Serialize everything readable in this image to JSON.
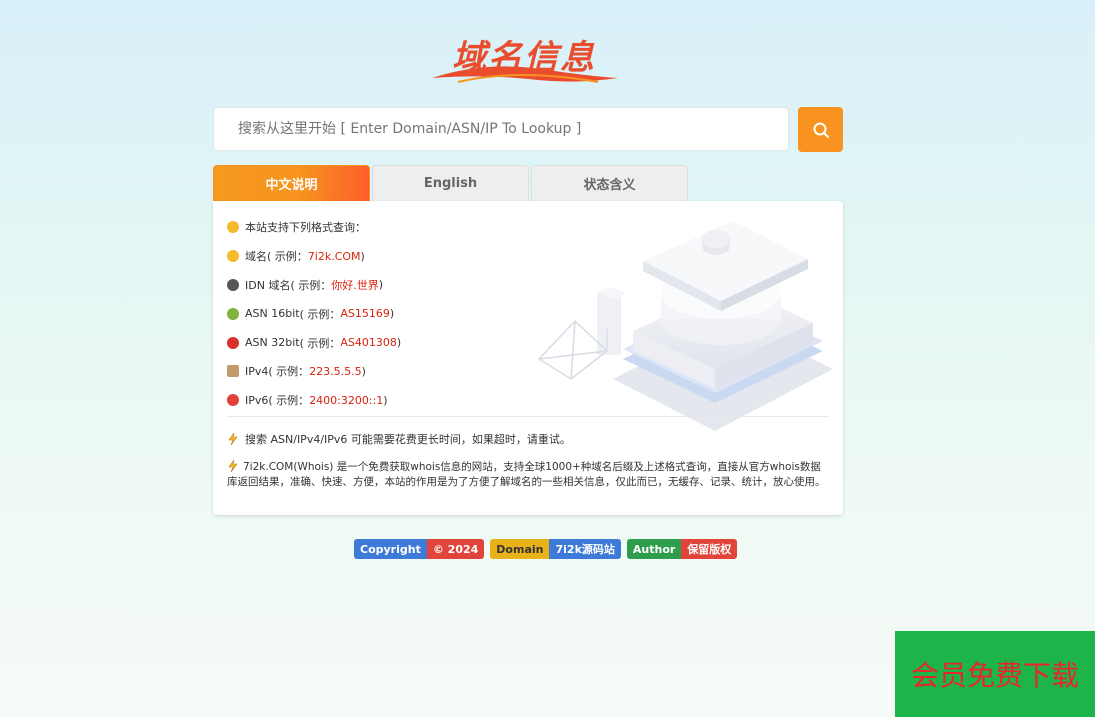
{
  "logo": {
    "text": "域名信息"
  },
  "search": {
    "placeholder": "搜索从这里开始 [ Enter Domain/ASN/IP To Lookup ]",
    "value": ""
  },
  "tabs": [
    {
      "label": "中文说明",
      "active": true
    },
    {
      "label": "English",
      "active": false
    },
    {
      "label": "状态含义",
      "active": false
    }
  ],
  "panel": {
    "intro": "本站支持下列格式查询：",
    "formats": [
      {
        "icon": "emoji-cool-icon",
        "label": "域名",
        "prefix": " ( 示例：",
        "example": "7i2k.COM",
        "suffix": " )"
      },
      {
        "icon": "emoji-eyes-icon",
        "label": "IDN 域名",
        "prefix": " ( 示例：",
        "example": "你好.世界",
        "suffix": " )"
      },
      {
        "icon": "emoji-sprout-icon",
        "label": "ASN 16bit",
        "prefix": " ( 示例：",
        "example": "AS15169",
        "suffix": " )"
      },
      {
        "icon": "emoji-shoe-icon",
        "label": "ASN 32bit",
        "prefix": " ( 示例：",
        "example": "AS401308",
        "suffix": " )"
      },
      {
        "icon": "emoji-sign-icon",
        "label": "IPv4",
        "prefix": " ( 示例：",
        "example": "223.5.5.5",
        "suffix": " )"
      },
      {
        "icon": "emoji-mushroom-icon",
        "label": "IPv6",
        "prefix": " ( 示例：",
        "example": "2400:3200::1",
        "suffix": " )"
      }
    ],
    "note1": "搜索 ASN/IPv4/IPv6 可能需要花费更长时间，如果超时，请重试。",
    "note2": "7i2k.COM(Whois) 是一个免费获取whois信息的网站，支持全球1000+种域名后缀及上述格式查询，直接从官方whois数据库返回结果，准确、快速、方便，本站的作用是为了方便了解域名的一些相关信息，仅此而已，无缓存、记录、统计，放心使用。"
  },
  "badges": [
    {
      "left": "Copyright",
      "right": "© 2024",
      "left_color": "#3e7bd9",
      "right_color": "#e0443a"
    },
    {
      "left": "Domain",
      "right": "7i2k源码站",
      "left_color": "#e9b21b",
      "right_color": "#3e7bd9"
    },
    {
      "left": "Author",
      "right": "保留版权",
      "left_color": "#2e9e4e",
      "right_color": "#e0443a"
    }
  ],
  "promo": {
    "text": "会员免费下载"
  },
  "colors": {
    "accent": "#f7931e",
    "example_red": "#d9230f",
    "promo_green": "#1db54a",
    "promo_text": "#e8242d"
  }
}
